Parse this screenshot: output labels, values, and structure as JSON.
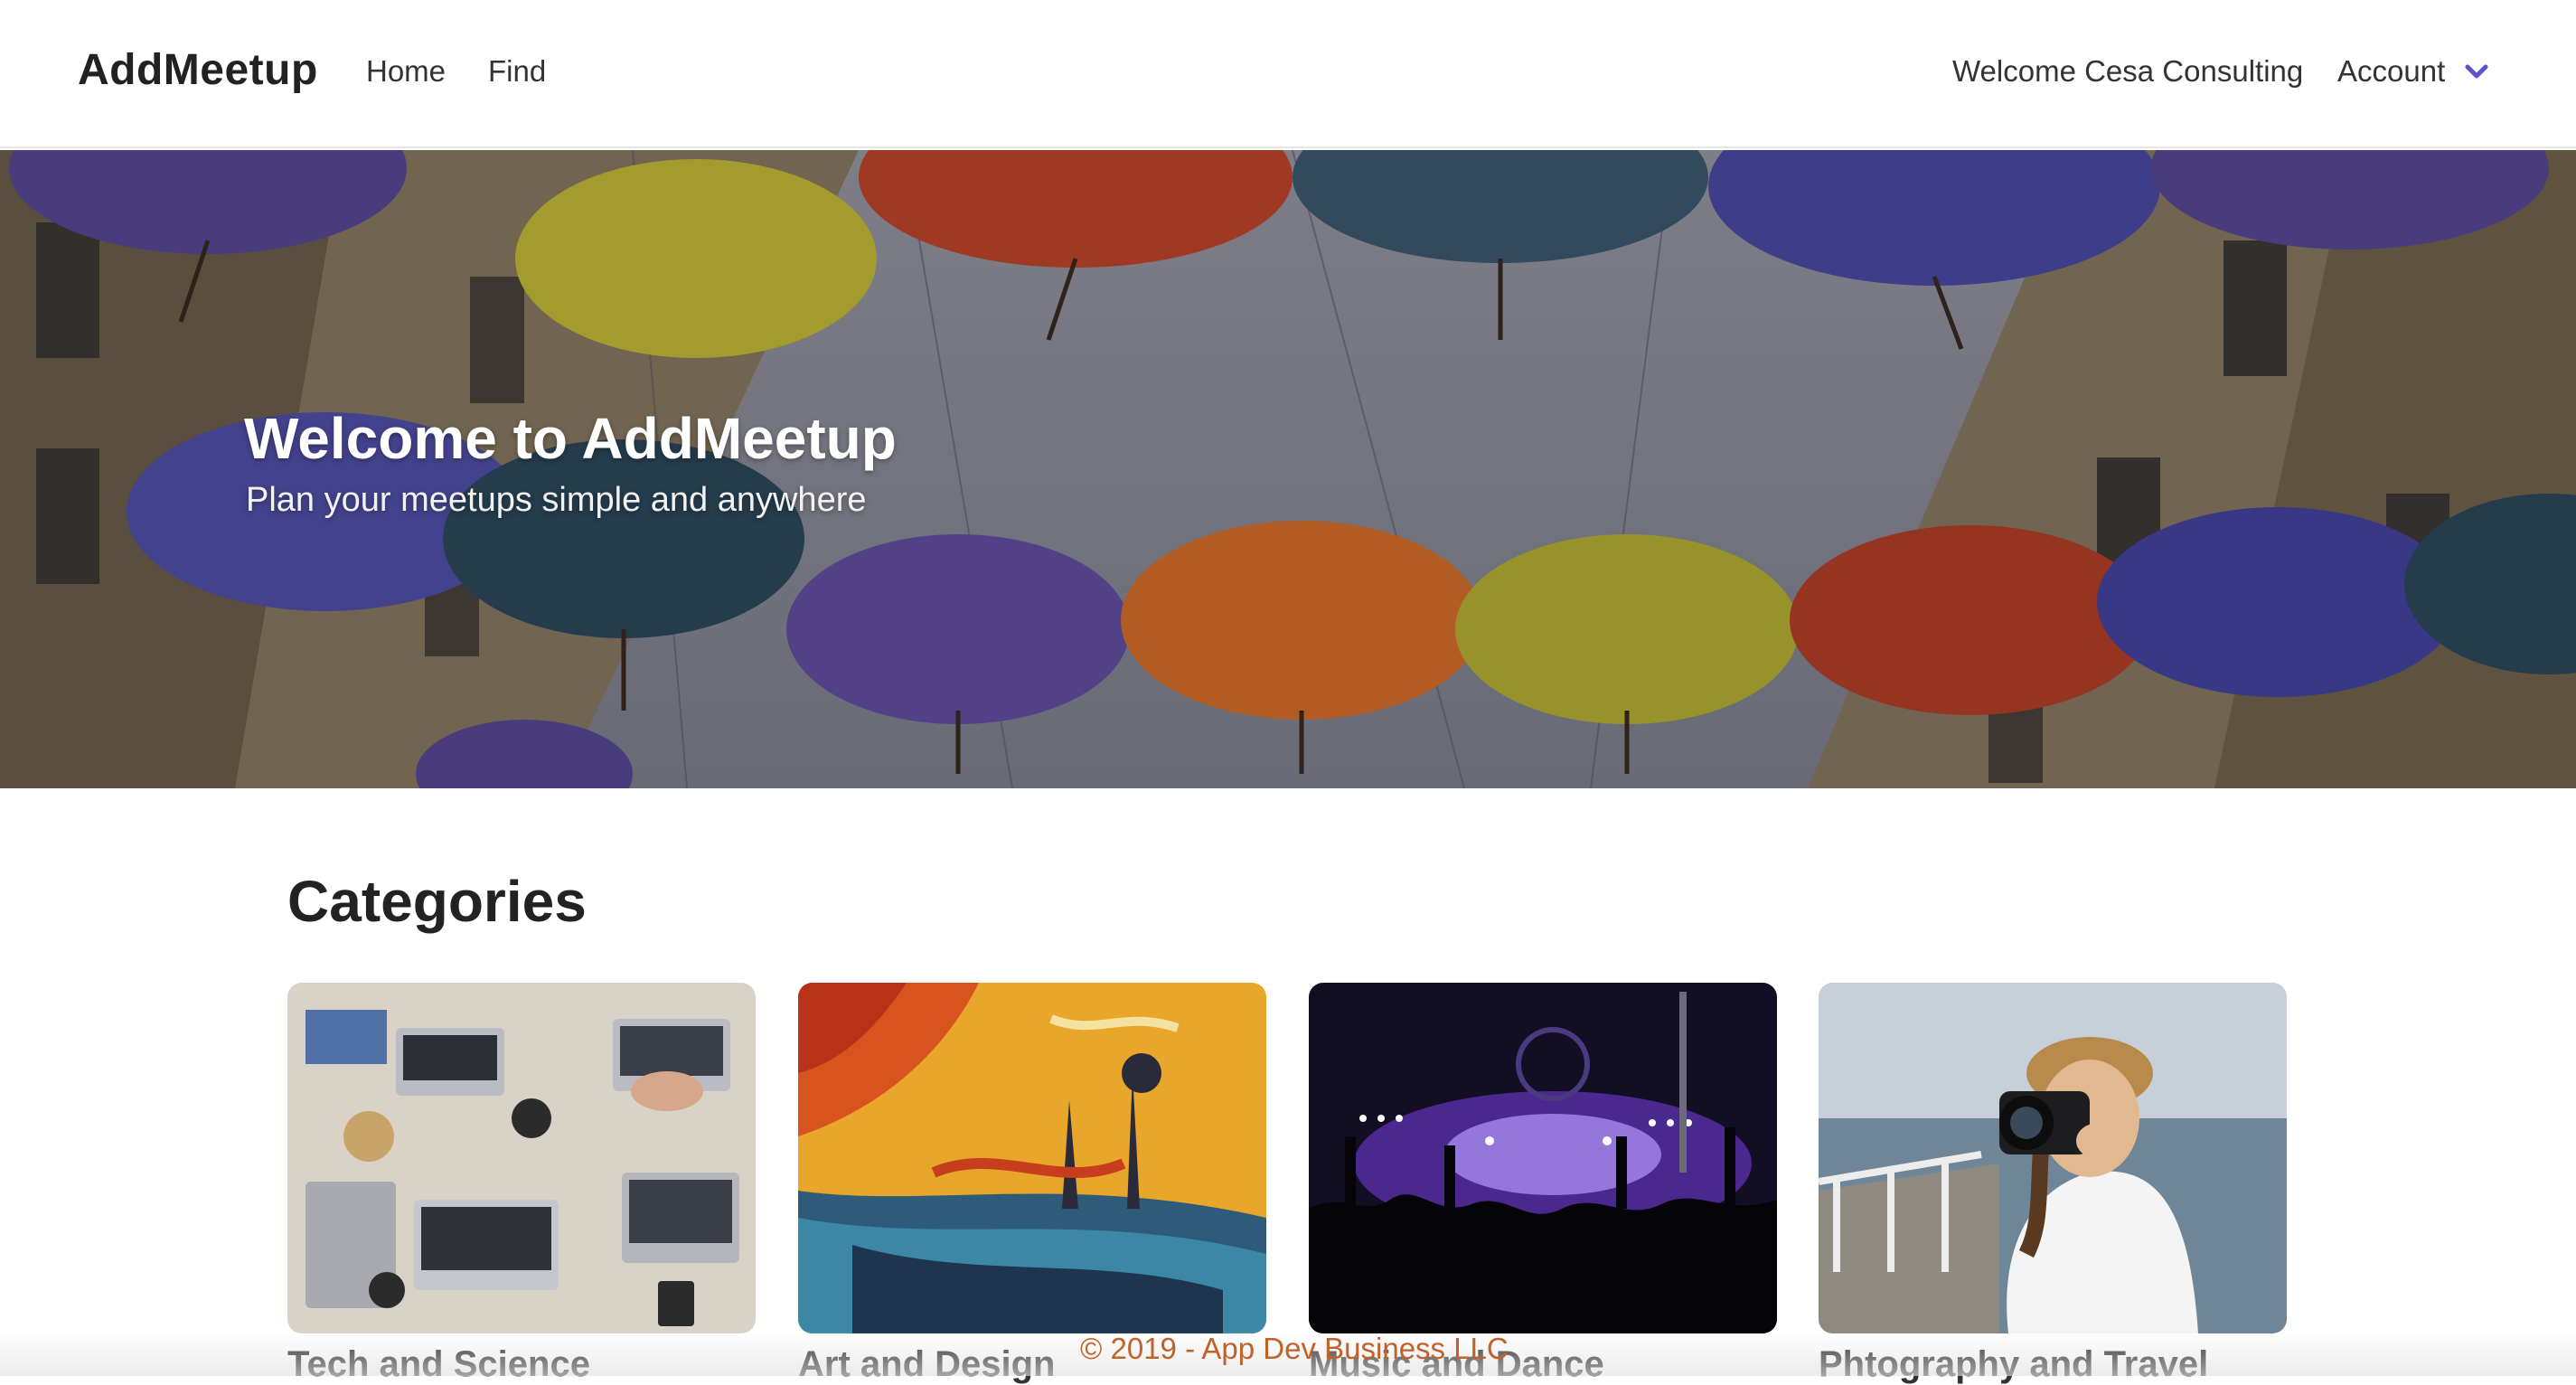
{
  "brand": "AddMeetup",
  "nav": {
    "home": "Home",
    "find": "Find",
    "welcome": "Welcome Cesa Consulting",
    "account": "Account",
    "account_icon": "chevron-down-icon",
    "accent_color": "#5b57c9"
  },
  "hero": {
    "title": "Welcome to AddMeetup",
    "subtitle": "Plan your meetups simple and anywhere"
  },
  "categories": {
    "heading": "Categories",
    "items": [
      {
        "label": "Tech and Science"
      },
      {
        "label": "Art and Design"
      },
      {
        "label": "Music and Dance"
      },
      {
        "label": "Phtography and Travel"
      }
    ]
  },
  "footer": {
    "text": "© 2019 - App Dev Business LLC",
    "color": "#c0622b"
  }
}
